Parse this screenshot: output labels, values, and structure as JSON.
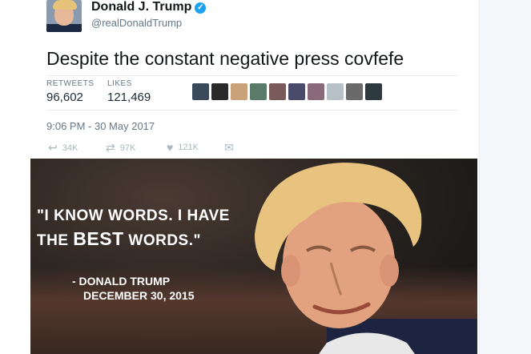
{
  "tweet": {
    "author_name": "Donald J. Trump",
    "handle": "@realDonaldTrump",
    "verified": true,
    "text": "Despite the constant negative press covfefe",
    "stats": {
      "retweets_label": "RETWEETS",
      "retweets_value": "96,602",
      "likes_label": "LIKES",
      "likes_value": "121,469"
    },
    "timestamp": "9:06 PM - 30 May 2017",
    "actions": {
      "reply_icon": "reply-icon",
      "retweet_icon": "retweet-icon",
      "retweet_count": "97K",
      "like_icon": "heart-icon",
      "like_count": "121K",
      "dm_icon": "envelope-icon",
      "reply_count": "34K"
    }
  },
  "meme": {
    "quote_line1": "\"I know words. I have",
    "quote_line2_pre": "the",
    "quote_line2_best": "BEST",
    "quote_line2_post": "words.\"",
    "attribution_line1": "- Donald Trump",
    "attribution_line2": "December 30, 2015"
  },
  "colors": {
    "verified_badge": "#1da1f2",
    "text_primary": "#14171a",
    "text_secondary": "#657786",
    "action_gray": "#aab8c2"
  }
}
